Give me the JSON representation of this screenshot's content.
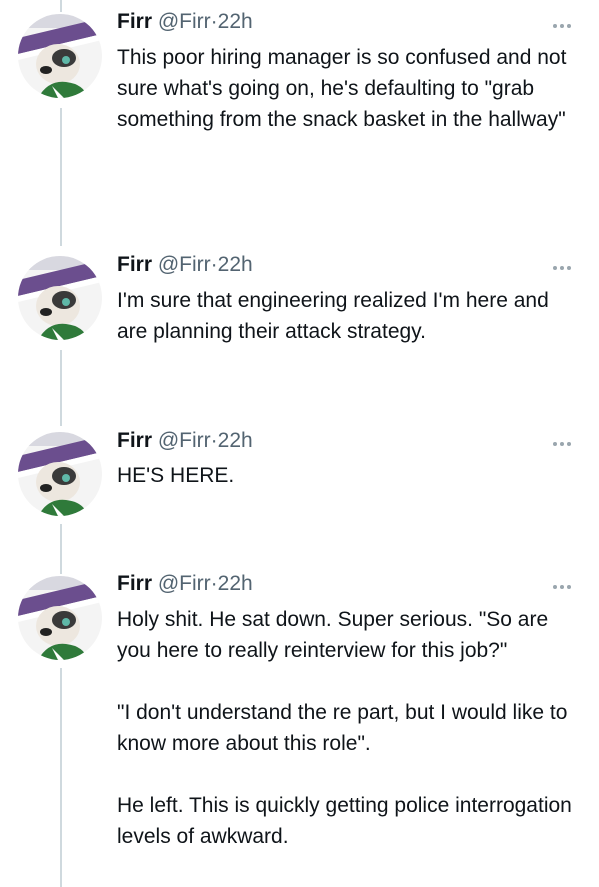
{
  "author": {
    "name": "Firr",
    "handle": "@Firr",
    "separator": "·"
  },
  "colors": {
    "text": "#0f1419",
    "secondary": "#536471",
    "thread_line": "#cfd9de",
    "background": "#ffffff"
  },
  "icons": {
    "more": "more-horizontal-icon",
    "avatar": "fox-avatar"
  },
  "tweets": [
    {
      "time": "22h",
      "paragraphs": [
        "This poor hiring manager is so confused and not sure what's going on, he's defaulting to \"grab something from the snack basket in the hallway\""
      ]
    },
    {
      "time": "22h",
      "paragraphs": [
        "I'm sure that engineering realized I'm here and are planning their attack strategy."
      ]
    },
    {
      "time": "22h",
      "paragraphs": [
        "HE'S HERE."
      ]
    },
    {
      "time": "22h",
      "paragraphs": [
        "Holy shit.  He sat down. Super serious. \"So are you here to really reinterview for this job?\"",
        "\"I don't understand the re part, but I would like to know more about this role\".",
        "He left.  This is quickly getting police interrogation levels of awkward."
      ]
    }
  ]
}
